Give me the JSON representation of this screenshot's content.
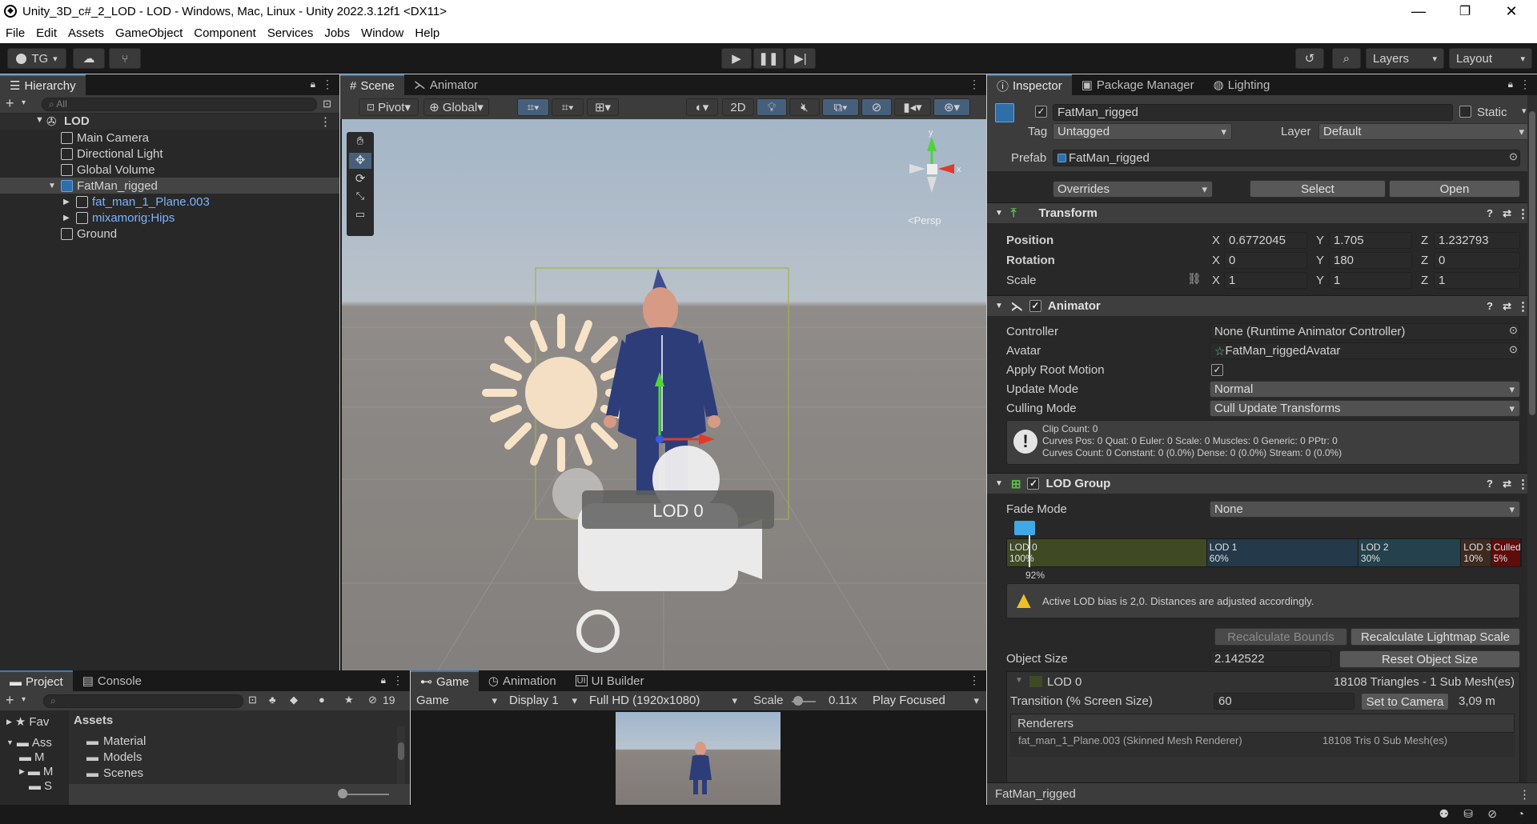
{
  "window": {
    "title": "Unity_3D_c#_2_LOD - LOD - Windows, Mac, Linux - Unity 2022.3.12f1 <DX11>",
    "minimize": "—",
    "restore": "❐",
    "close": "✕"
  },
  "menu": [
    "File",
    "Edit",
    "Assets",
    "GameObject",
    "Component",
    "Services",
    "Jobs",
    "Window",
    "Help"
  ],
  "toolbar": {
    "account": "TG",
    "layers": "Layers",
    "layout": "Layout"
  },
  "hierarchy": {
    "tab": "Hierarchy",
    "search_placeholder": "All",
    "scene": "LOD",
    "items": [
      {
        "label": "Main Camera"
      },
      {
        "label": "Directional Light"
      },
      {
        "label": "Global Volume"
      },
      {
        "label": "FatMan_rigged"
      },
      {
        "label": "fat_man_1_Plane.003"
      },
      {
        "label": "mixamorig:Hips"
      },
      {
        "label": "Ground"
      }
    ]
  },
  "scene_view": {
    "tabs": [
      "Scene",
      "Animator"
    ],
    "pivot": "Pivot",
    "global": "Global",
    "mode_2d": "2D",
    "persp": "<Persp",
    "lod_label": "LOD 0",
    "axis_x": "x",
    "axis_y": "y"
  },
  "inspector": {
    "tabs": [
      "Inspector",
      "Package Manager",
      "Lighting"
    ],
    "object_name": "FatMan_rigged",
    "static_label": "Static",
    "tag_label": "Tag",
    "tag_value": "Untagged",
    "layer_label": "Layer",
    "layer_value": "Default",
    "prefab_label": "Prefab",
    "prefab_value": "FatMan_rigged",
    "overrides": "Overrides",
    "select": "Select",
    "open": "Open",
    "transform": {
      "title": "Transform",
      "position_label": "Position",
      "rotation_label": "Rotation",
      "scale_label": "Scale",
      "position": {
        "x": "0.6772045",
        "y": "1.705",
        "z": "1.232793"
      },
      "rotation": {
        "x": "0",
        "y": "180",
        "z": "0"
      },
      "scale": {
        "x": "1",
        "y": "1",
        "z": "1"
      }
    },
    "animator": {
      "title": "Animator",
      "controller_label": "Controller",
      "controller_value": "None (Runtime Animator Controller)",
      "avatar_label": "Avatar",
      "avatar_value": "FatMan_riggedAvatar",
      "root_motion_label": "Apply Root Motion",
      "update_mode_label": "Update Mode",
      "update_mode_value": "Normal",
      "culling_label": "Culling Mode",
      "culling_value": "Cull Update Transforms",
      "info_1": "Clip Count: 0",
      "info_2": "Curves Pos: 0 Quat: 0 Euler: 0 Scale: 0 Muscles: 0 Generic: 0 PPtr: 0",
      "info_3": "Curves Count: 0 Constant: 0 (0.0%) Dense: 0 (0.0%) Stream: 0 (0.0%)"
    },
    "lod_group": {
      "title": "LOD Group",
      "fade_label": "Fade Mode",
      "fade_value": "None",
      "levels": [
        {
          "name": "LOD 0",
          "pct": "100%",
          "share": 0.4,
          "color": "#3f4a25"
        },
        {
          "name": "LOD 1",
          "pct": "60%",
          "share": 0.3,
          "color": "#24394a"
        },
        {
          "name": "LOD 2",
          "pct": "30%",
          "share": 0.2,
          "color": "#24414c"
        },
        {
          "name": "LOD 3",
          "pct": "10%",
          "share": 0.05,
          "color": "#3d2a20"
        },
        {
          "name": "Culled",
          "pct": "5%",
          "share": 0.05,
          "color": "#5e0c0c"
        }
      ],
      "camera_pct": "92%",
      "warning": "Active LOD bias is 2,0. Distances are adjusted accordingly.",
      "recalc_bounds": "Recalculate Bounds",
      "recalc_lightmap": "Recalculate Lightmap Scale",
      "object_size_label": "Object Size",
      "object_size_value": "2.142522",
      "reset_size": "Reset Object Size",
      "lod0_label": "LOD 0",
      "lod0_info": "18108 Triangles  - 1 Sub Mesh(es)",
      "transition_label": "Transition (% Screen Size)",
      "transition_value": "60",
      "set_camera": "Set to Camera",
      "distance": "3,09 m",
      "renderers_label": "Renderers",
      "renderer_partial": "fat_man_1_Plane.003 (Skinned Mesh Renderer)",
      "renderer_info": "18108 Tris  0 Sub Mesh(es)"
    },
    "footer_name": "FatMan_rigged"
  },
  "project": {
    "tabs": [
      "Project",
      "Console"
    ],
    "count": "19",
    "favorites": "Fav",
    "assets_root": "Ass",
    "assets_header": "Assets",
    "tree_items": [
      "M",
      "M",
      "S"
    ],
    "folders": [
      "Material",
      "Models",
      "Scenes"
    ]
  },
  "game": {
    "tabs": [
      "Game",
      "Animation",
      "UI Builder"
    ],
    "game_label": "Game",
    "display": "Display 1",
    "resolution": "Full HD (1920x1080)",
    "scale_label": "Scale",
    "scale_value": "0.11x",
    "play_focused": "Play Focused"
  }
}
